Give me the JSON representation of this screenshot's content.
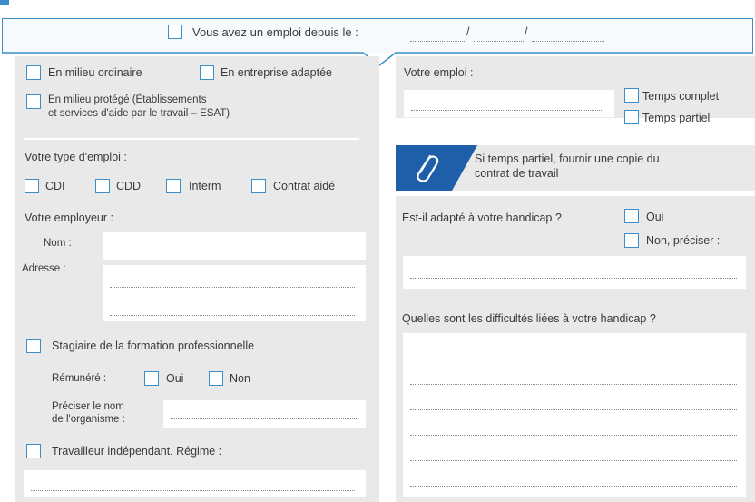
{
  "header": {
    "since_label": "Vous avez un emploi depuis le :",
    "date_sep1": "/",
    "date_sep2": "/"
  },
  "left": {
    "milieu_ordinaire": "En milieu ordinaire",
    "entreprise_adaptee": "En entreprise adaptée",
    "milieu_protege_line1": "En milieu protégé (Établissements",
    "milieu_protege_line2": "et services d'aide par le travail – ESAT)",
    "type_emploi_title": "Votre type d'emploi :",
    "type_options": [
      "CDI",
      "CDD",
      "Interm",
      "Contrat aidé"
    ],
    "employeur_title": "Votre employeur :",
    "nom_label": "Nom :",
    "adresse_label": "Adresse :",
    "stagiaire_label": "Stagiaire de la formation professionnelle",
    "remunere_label": "Rémunéré :",
    "oui_label": "Oui",
    "non_label": "Non",
    "preciser_line1": "Préciser le nom",
    "preciser_line2": "de l'organisme :",
    "independant_label": "Travailleur indépendant. Régime :"
  },
  "right": {
    "votre_emploi_title": "Votre emploi :",
    "temps_complet": "Temps complet",
    "temps_partiel": "Temps partiel",
    "note_line1": "Si temps partiel, fournir une copie du",
    "note_line2": "contrat de travail",
    "adapte_question": "Est-il adapté à votre handicap ?",
    "oui_label": "Oui",
    "non_preciser_label": "Non, préciser :",
    "difficultes_question": "Quelles sont les difficultés liées à votre handicap ?"
  },
  "colors": {
    "accent": "#3b8fc9",
    "panel": "#e9e9e9",
    "note_band": "#1f5ea8"
  },
  "icons": [
    "paperclip-icon"
  ]
}
